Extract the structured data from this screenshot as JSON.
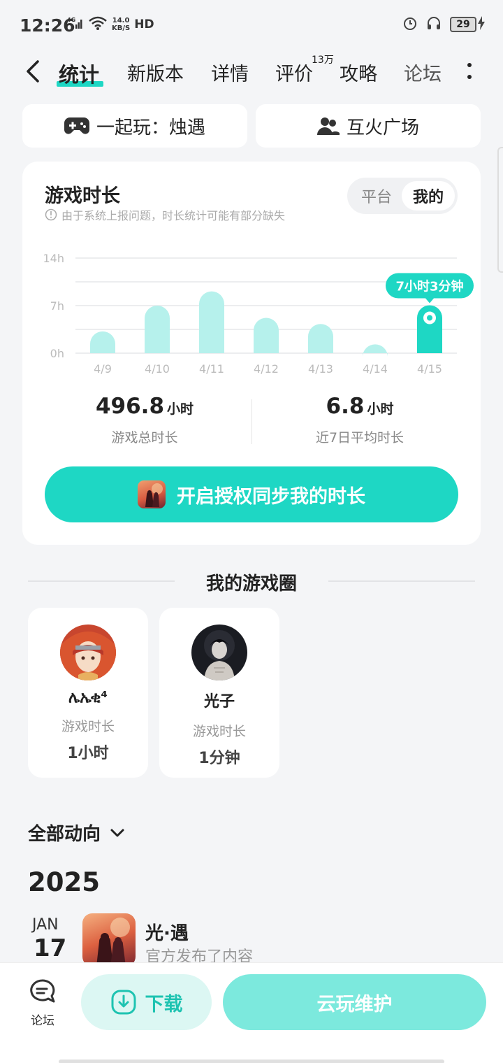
{
  "status_bar": {
    "time": "12:26",
    "network": "4G",
    "speed_value": "14.0",
    "speed_unit": "KB/S",
    "hd": "HD",
    "battery": "29"
  },
  "tabs": {
    "items": [
      "统计",
      "新版本",
      "详情",
      "评价",
      "攻略",
      "论坛"
    ],
    "active": "统计",
    "review_count": "13万"
  },
  "quick_actions": {
    "play_together": "一起玩：烛遇",
    "plaza": "互火广场"
  },
  "playtime_card": {
    "title": "游戏时长",
    "hint": "由于系统上报问题，时长统计可能有部分缺失",
    "toggle": {
      "platform": "平台",
      "mine": "我的",
      "selected": "我的"
    },
    "total_value": "496.8",
    "total_unit": "小时",
    "total_label": "游戏总时长",
    "avg_value": "6.8",
    "avg_unit": "小时",
    "avg_label": "近7日平均时长",
    "auth_button": "开启授权同步我的时长"
  },
  "chart_data": {
    "type": "bar",
    "categories": [
      "4/9",
      "4/10",
      "4/11",
      "4/12",
      "4/13",
      "4/14",
      "4/15"
    ],
    "values": [
      3.2,
      7.0,
      9.1,
      5.2,
      4.3,
      1.3,
      7.05
    ],
    "yticks": [
      "14h",
      "7h",
      "0h"
    ],
    "ylim": [
      0,
      14
    ],
    "highlight_index": 6,
    "highlight_label": "7小时3分钟",
    "bar_color": "#b6f1ec",
    "highlight_color": "#1ed7c4",
    "grid": true
  },
  "game_circle": {
    "title": "我的游戏圈",
    "friends": [
      {
        "name": "ሌኤቂ⁴",
        "label": "游戏时长",
        "time": "1小时"
      },
      {
        "name": "光子",
        "label": "游戏时长",
        "time": "1分钟"
      }
    ]
  },
  "feed": {
    "filter": "全部动向",
    "year": "2025",
    "items": [
      {
        "month": "JAN",
        "day": "17",
        "title": "光·遇",
        "desc": "官方发布了内容"
      }
    ]
  },
  "bottom_bar": {
    "forum": "论坛",
    "download": "下载",
    "cloud_play": "云玩维护"
  },
  "colors": {
    "accent": "#1ed7c4",
    "accent_light": "#b6f1ec",
    "background": "#f4f5f7"
  }
}
